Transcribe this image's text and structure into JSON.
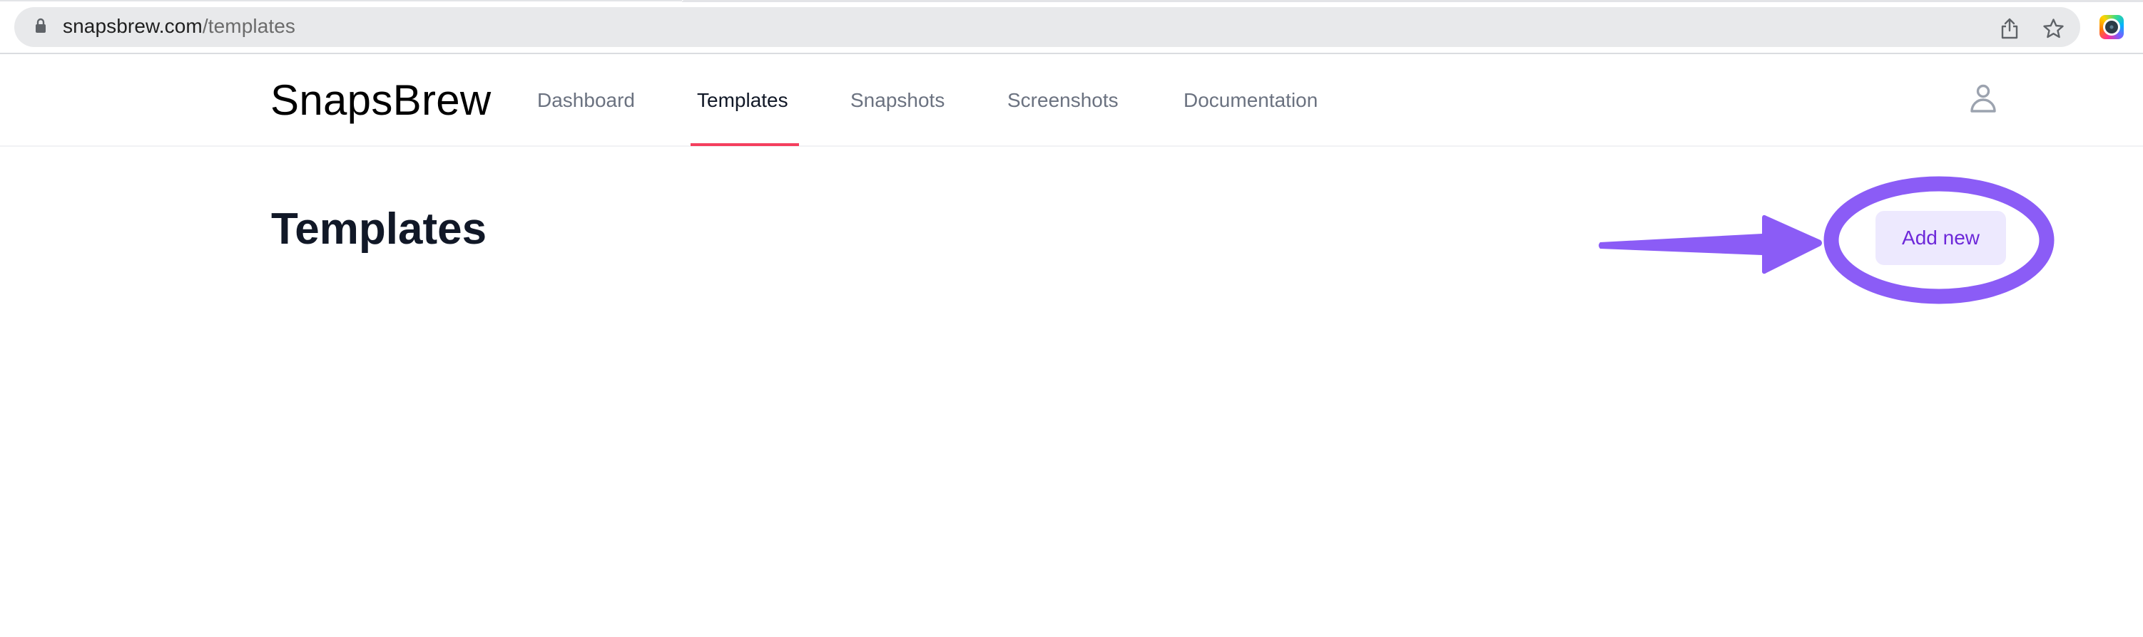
{
  "browser": {
    "url_domain": "snapsbrew.com",
    "url_path": "/templates",
    "icons": {
      "lock": "lock-icon",
      "share": "share-icon",
      "bookmark": "star-icon",
      "extension": "extension-icon"
    }
  },
  "header": {
    "logo": "SnapsBrew",
    "nav": [
      {
        "label": "Dashboard",
        "active": false
      },
      {
        "label": "Templates",
        "active": true
      },
      {
        "label": "Snapshots",
        "active": false
      },
      {
        "label": "Screenshots",
        "active": false
      },
      {
        "label": "Documentation",
        "active": false
      }
    ],
    "user_icon": "user-icon",
    "active_underline_color": "#f43f5e"
  },
  "main": {
    "title": "Templates",
    "add_new_label": "Add new"
  },
  "annotation": {
    "type": "arrow-and-circle",
    "target": "add-new-button",
    "color": "#8b5cf6"
  }
}
